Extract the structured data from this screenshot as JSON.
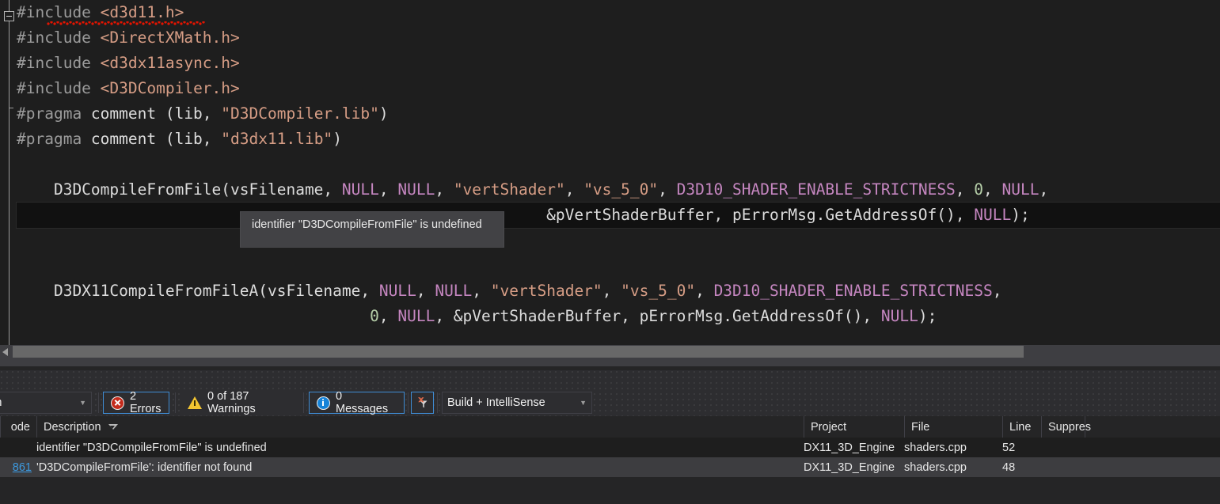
{
  "editor": {
    "lines": [
      {
        "tokens": [
          {
            "t": "#include ",
            "c": "dir"
          },
          {
            "t": "<d3d11.h>",
            "c": "str"
          }
        ]
      },
      {
        "tokens": [
          {
            "t": "#include ",
            "c": "dir"
          },
          {
            "t": "<DirectXMath.h>",
            "c": "str"
          }
        ]
      },
      {
        "tokens": [
          {
            "t": "#include ",
            "c": "dir"
          },
          {
            "t": "<d3dx11async.h>",
            "c": "str"
          }
        ]
      },
      {
        "tokens": [
          {
            "t": "#include ",
            "c": "dir"
          },
          {
            "t": "<D3DCompiler.h>",
            "c": "str"
          }
        ]
      },
      {
        "tokens": [
          {
            "t": "#pragma ",
            "c": "dir"
          },
          {
            "t": "comment (lib, ",
            "c": "plain"
          },
          {
            "t": "\"D3DCompiler.lib\"",
            "c": "str"
          },
          {
            "t": ")",
            "c": "plain"
          }
        ]
      },
      {
        "tokens": [
          {
            "t": "#pragma ",
            "c": "dir"
          },
          {
            "t": "comment (lib, ",
            "c": "plain"
          },
          {
            "t": "\"d3dx11.lib\"",
            "c": "str"
          },
          {
            "t": ")",
            "c": "plain"
          }
        ]
      },
      {
        "tokens": []
      },
      {
        "tokens": [
          {
            "t": "    D3DCompileFromFile(vsFilename, ",
            "c": "plain"
          },
          {
            "t": "NULL",
            "c": "macro"
          },
          {
            "t": ", ",
            "c": "plain"
          },
          {
            "t": "NULL",
            "c": "macro"
          },
          {
            "t": ", ",
            "c": "plain"
          },
          {
            "t": "\"vertShader\"",
            "c": "str"
          },
          {
            "t": ", ",
            "c": "plain"
          },
          {
            "t": "\"vs_5_0\"",
            "c": "str"
          },
          {
            "t": ", ",
            "c": "plain"
          },
          {
            "t": "D3D10_SHADER_ENABLE_STRICTNESS",
            "c": "macro"
          },
          {
            "t": ", ",
            "c": "plain"
          },
          {
            "t": "0",
            "c": "num"
          },
          {
            "t": ", ",
            "c": "plain"
          },
          {
            "t": "NULL",
            "c": "macro"
          },
          {
            "t": ",",
            "c": "plain"
          }
        ]
      },
      {
        "highlight": true,
        "tokens": [
          {
            "t": "                                                         &pVertShaderBuffer, pErrorMsg.GetAddressOf(), ",
            "c": "plain"
          },
          {
            "t": "NULL",
            "c": "macro"
          },
          {
            "t": ");",
            "c": "plain"
          }
        ]
      },
      {
        "tokens": []
      },
      {
        "tokens": []
      },
      {
        "tokens": [
          {
            "t": "    D3DX11CompileFromFileA(vsFilename, ",
            "c": "plain"
          },
          {
            "t": "NULL",
            "c": "macro"
          },
          {
            "t": ", ",
            "c": "plain"
          },
          {
            "t": "NULL",
            "c": "macro"
          },
          {
            "t": ", ",
            "c": "plain"
          },
          {
            "t": "\"vertShader\"",
            "c": "str"
          },
          {
            "t": ", ",
            "c": "plain"
          },
          {
            "t": "\"vs_5_0\"",
            "c": "str"
          },
          {
            "t": ", ",
            "c": "plain"
          },
          {
            "t": "D3D10_SHADER_ENABLE_STRICTNESS",
            "c": "macro"
          },
          {
            "t": ",",
            "c": "plain"
          }
        ]
      },
      {
        "tokens": [
          {
            "t": "                                      ",
            "c": "plain"
          },
          {
            "t": "0",
            "c": "num"
          },
          {
            "t": ", ",
            "c": "plain"
          },
          {
            "t": "NULL",
            "c": "macro"
          },
          {
            "t": ", &pVertShaderBuffer, pErrorMsg.GetAddressOf(), ",
            "c": "plain"
          },
          {
            "t": "NULL",
            "c": "macro"
          },
          {
            "t": ");",
            "c": "plain"
          }
        ]
      }
    ],
    "tooltip_text": "identifier \"D3DCompileFromFile\" is undefined"
  },
  "toolbar": {
    "scope_label": "ution",
    "errors_label": "2 Errors",
    "warnings_label": "0 of 187 Warnings",
    "messages_label": "0 Messages",
    "build_filter_label": "Build + IntelliSense"
  },
  "table": {
    "columns": [
      "ode",
      "Description",
      "Project",
      "File",
      "Line",
      "Suppres"
    ],
    "sorted_column": "Description",
    "rows": [
      {
        "code": "",
        "description": "identifier \"D3DCompileFromFile\" is undefined",
        "project": "DX11_3D_Engine",
        "file": "shaders.cpp",
        "line": "52",
        "suppression": ""
      },
      {
        "code": "861",
        "description": "'D3DCompileFromFile': identifier not found",
        "project": "DX11_3D_Engine",
        "file": "shaders.cpp",
        "line": "48",
        "suppression": ""
      }
    ]
  },
  "colors": {
    "editor_bg": "#1e1e1e",
    "panel_bg": "#252526",
    "accent_blue": "#3f8cd4",
    "error_red": "#c42b1c",
    "warning_yellow": "#f2c531",
    "info_blue": "#1683d8",
    "link_blue": "#3d9ae0"
  }
}
